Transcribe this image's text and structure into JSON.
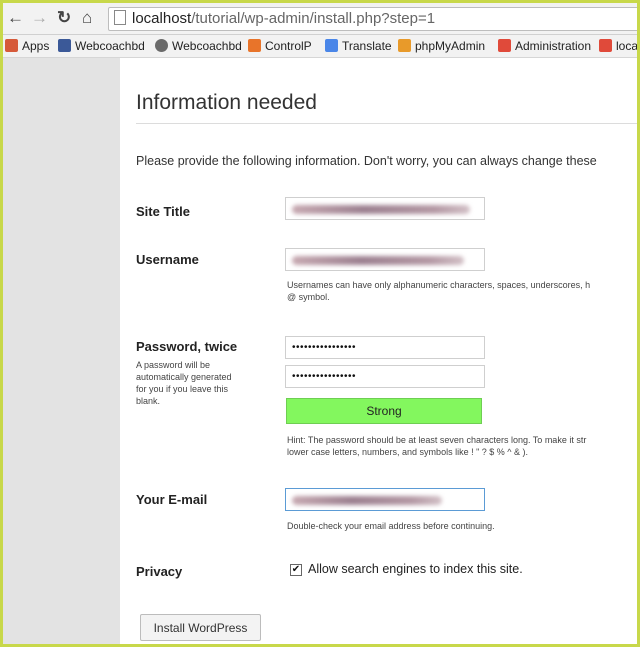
{
  "browser": {
    "url_host": "localhost",
    "url_path": "/tutorial/wp-admin/install.php?step=1",
    "bookmarks": [
      {
        "label": "Apps",
        "icon": "apps-grid-icon",
        "color": "#d65a3a"
      },
      {
        "label": "Webcoachbd",
        "icon": "facebook-icon",
        "color": "#3b5998"
      },
      {
        "label": "Webcoachbd",
        "icon": "globe-icon",
        "color": "#6a6a6a"
      },
      {
        "label": "ControlP",
        "icon": "cpanel-icon",
        "color": "#e8742a"
      },
      {
        "label": "Translate",
        "icon": "translate-icon",
        "color": "#4a86e8"
      },
      {
        "label": "phpMyAdmin",
        "icon": "phpmyadmin-icon",
        "color": "#e89a2a"
      },
      {
        "label": "Administration",
        "icon": "joomla-icon",
        "color": "#e04a3a"
      },
      {
        "label": "loca",
        "icon": "joomla-icon",
        "color": "#e04a3a"
      }
    ]
  },
  "form": {
    "heading": "Information needed",
    "intro": "Please provide the following information. Don't worry, you can always change these",
    "site_title_label": "Site Title",
    "username_label": "Username",
    "username_hint_1": "Usernames can have only alphanumeric characters, spaces, underscores, h",
    "username_hint_2": "@ symbol.",
    "password_label": "Password, twice",
    "password_note_1": "A password will be",
    "password_note_2": "automatically generated",
    "password_note_3": "for you if you leave this",
    "password_note_4": "blank.",
    "password_1": "••••••••••••••••",
    "password_2": "••••••••••••••••",
    "strength": "Strong",
    "password_hint_1": "Hint: The password should be at least seven characters long. To make it str",
    "password_hint_2": "lower case letters, numbers, and symbols like ! \" ? $ % ^ & ).",
    "email_label": "Your E-mail",
    "email_hint": "Double-check your email address before continuing.",
    "privacy_label": "Privacy",
    "privacy_checked": "✔",
    "privacy_option": "Allow search engines to index this site.",
    "install_button": "Install WordPress"
  },
  "colors": {
    "strength_strong": "#83f75e",
    "border_frame": "#c8d84a",
    "focus_border": "#5b9bd5"
  }
}
